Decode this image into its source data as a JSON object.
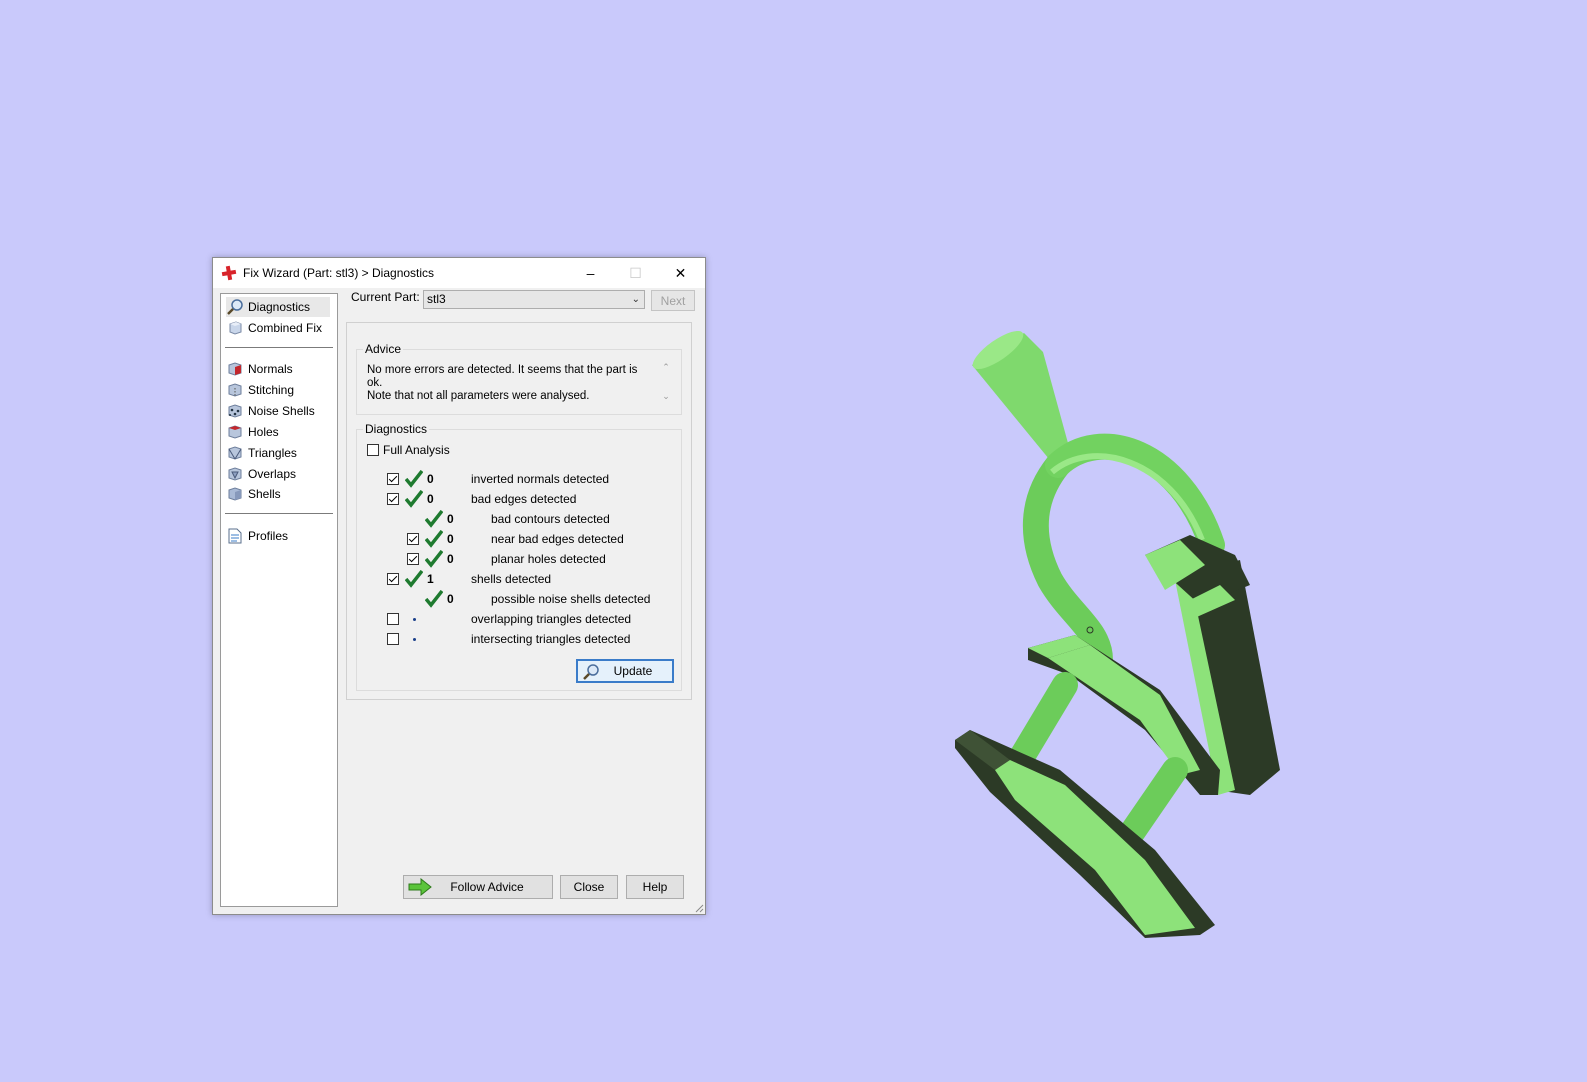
{
  "window": {
    "title": "Fix Wizard (Part: stl3) > Diagnostics",
    "minimize": "–",
    "maximize": "☐",
    "close": "✕"
  },
  "sidebar": {
    "items": [
      {
        "label": "Diagnostics",
        "icon": "magnifier-icon",
        "selected": true
      },
      {
        "label": "Combined Fix",
        "icon": "cube-icon"
      },
      {
        "label": "Normals",
        "icon": "normals-cube-icon"
      },
      {
        "label": "Stitching",
        "icon": "stitching-cube-icon"
      },
      {
        "label": "Noise Shells",
        "icon": "noise-shells-icon"
      },
      {
        "label": "Holes",
        "icon": "holes-cube-icon"
      },
      {
        "label": "Triangles",
        "icon": "triangles-cube-icon"
      },
      {
        "label": "Overlaps",
        "icon": "overlaps-cube-icon"
      },
      {
        "label": "Shells",
        "icon": "shells-cube-icon"
      },
      {
        "label": "Profiles",
        "icon": "document-icon"
      }
    ]
  },
  "current_part": {
    "label": "Current Part:",
    "value": "stl3",
    "next": "Next"
  },
  "advice": {
    "legend": "Advice",
    "line1": "No more errors are detected. It seems that the part is ok.",
    "line2": "Note that not all parameters were analysed."
  },
  "diagnostics": {
    "legend": "Diagnostics",
    "full_analysis": "Full Analysis",
    "rows": [
      {
        "count": "0",
        "label": "inverted normals detected",
        "checkbox": true,
        "checked": true,
        "status": "ok"
      },
      {
        "count": "0",
        "label": "bad edges detected",
        "checkbox": true,
        "checked": true,
        "status": "ok"
      },
      {
        "count": "0",
        "label": "bad contours detected",
        "checkbox": false,
        "status": "ok"
      },
      {
        "count": "0",
        "label": "near bad edges detected",
        "checkbox": true,
        "checked": true,
        "status": "ok"
      },
      {
        "count": "0",
        "label": "planar holes detected",
        "checkbox": true,
        "checked": true,
        "status": "ok"
      },
      {
        "count": "1",
        "label": "shells detected",
        "checkbox": true,
        "checked": true,
        "status": "ok"
      },
      {
        "count": "0",
        "label": "possible noise shells detected",
        "checkbox": false,
        "status": "ok"
      },
      {
        "count": "",
        "label": "overlapping triangles detected",
        "checkbox": true,
        "checked": false,
        "status": "unknown"
      },
      {
        "count": "",
        "label": "intersecting triangles detected",
        "checkbox": true,
        "checked": false,
        "status": "unknown"
      }
    ],
    "update": "Update"
  },
  "footer": {
    "follow_advice": "Follow Advice",
    "close": "Close",
    "help": "Help"
  },
  "colors": {
    "background": "#c9c9fb",
    "model_light": "#8de27a",
    "model_dark": "#2c3a26",
    "check_green": "#1e7a2f"
  }
}
